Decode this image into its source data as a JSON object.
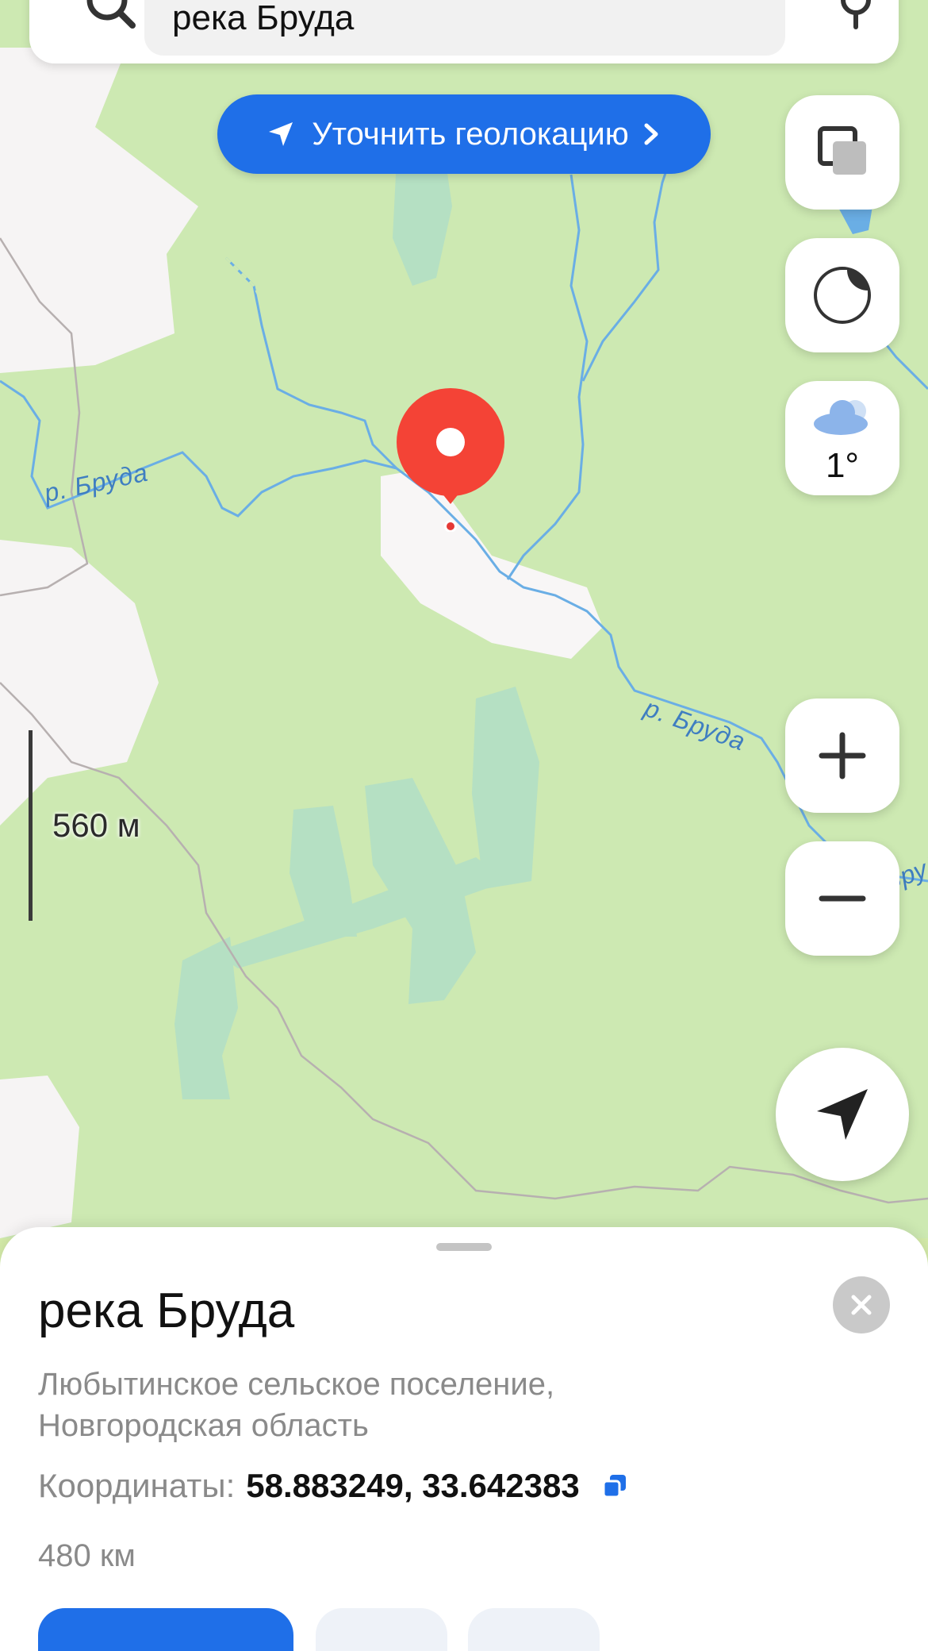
{
  "search": {
    "query": "река Бруда"
  },
  "map": {
    "geo_button_label": "Уточнить геолокацию",
    "river_labels": [
      "р. Бруда",
      "р. Бруда",
      "р. Бруда"
    ],
    "scale_label": "560 м",
    "weather_temp": "1°",
    "colors": {
      "land": "#cde9b2",
      "forest": "#b5e0c3",
      "open_area": "#f7f5f5",
      "water": "#6aaee5",
      "accent": "#1f6fe8",
      "marker": "#f44336"
    }
  },
  "controls": {
    "icons": [
      "layers-icon",
      "theme-icon",
      "weather-icon",
      "zoom-in-icon",
      "zoom-out-icon",
      "locate-arrow-icon"
    ]
  },
  "place": {
    "title": "река Бруда",
    "subtitle": "Любытинское сельское поселение, Новгородская область",
    "coords_label": "Координаты:",
    "coords_value": "58.883249, 33.642383",
    "distance": "480 км"
  }
}
